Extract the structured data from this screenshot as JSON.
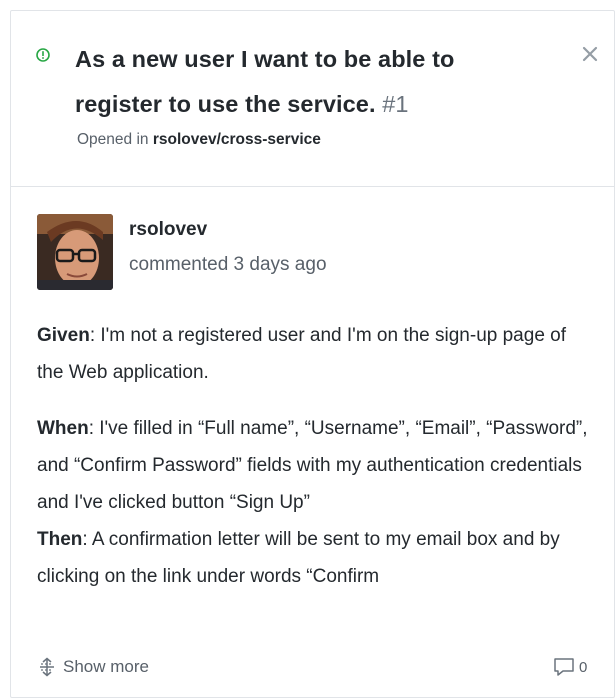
{
  "issue": {
    "title": "As a new user I want to be able to register to use the service.",
    "number": "#1",
    "opened_prefix": "Opened in",
    "repo": "rsolovev/cross-service",
    "status_icon": "issue-opened-icon",
    "status_color": "#28a745"
  },
  "comment": {
    "author": "rsolovev",
    "timestamp": "commented 3 days ago",
    "given_label": "Given",
    "given_text": ": I'm not a registered user and I'm on the sign-up page of the Web application.",
    "when_label": "When",
    "when_text": ": I've filled in “Full name”, “Username”, “Email”, “Password”, and “Confirm Password” fields with my authentication credentials and I've clicked button “Sign Up”",
    "then_label": "Then",
    "then_text": ": A confirmation letter will be sent to my email box and by clicking on the link under words “Confirm"
  },
  "footer": {
    "show_more": "Show more",
    "comment_count": "0"
  }
}
